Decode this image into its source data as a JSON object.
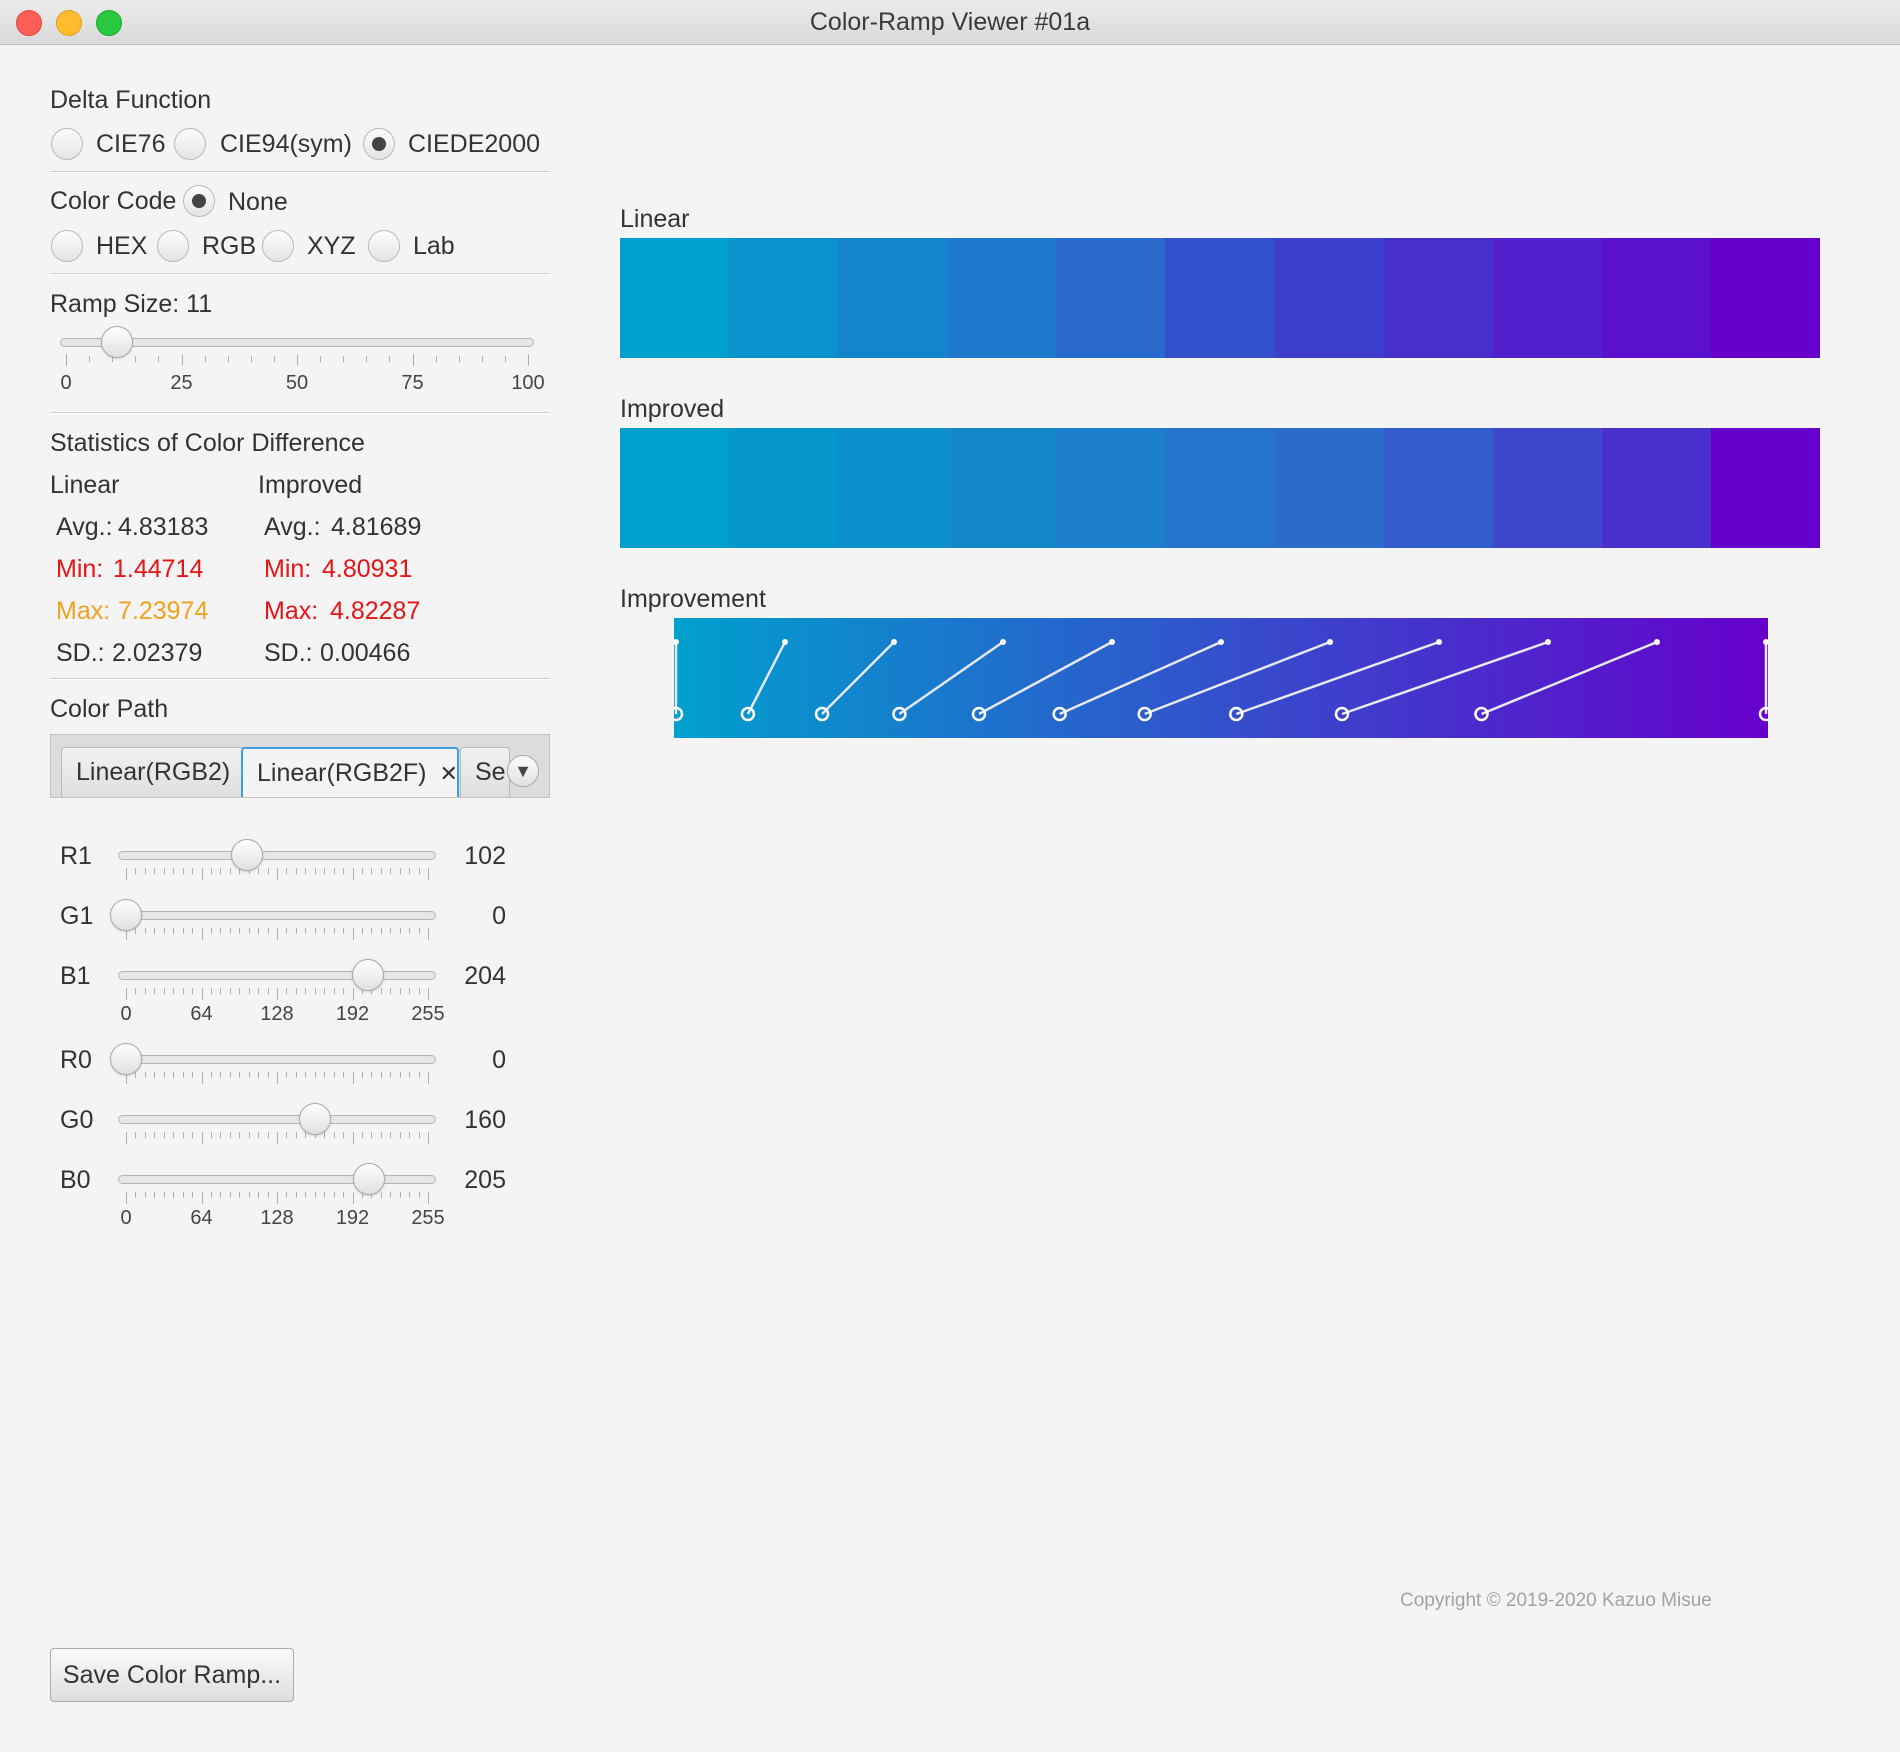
{
  "window": {
    "title": "Color-Ramp Viewer #01a"
  },
  "delta_function": {
    "label": "Delta Function",
    "options": [
      "CIE76",
      "CIE94(sym)",
      "CIEDE2000"
    ],
    "selected": "CIEDE2000"
  },
  "color_code": {
    "label": "Color Code",
    "options": [
      "None",
      "HEX",
      "RGB",
      "XYZ",
      "Lab"
    ],
    "selected": "None"
  },
  "ramp_size": {
    "label": "Ramp Size: 11",
    "value": 11,
    "min": 0,
    "max": 100,
    "tick_labels": [
      "0",
      "25",
      "50",
      "75",
      "100"
    ]
  },
  "statistics": {
    "title": "Statistics of Color Difference",
    "linear": {
      "header": "Linear",
      "avg_label": "Avg.:",
      "avg": "4.83183",
      "min_label": "Min:",
      "min": "1.44714",
      "max_label": "Max:",
      "max": "7.23974",
      "sd_label": "SD.:",
      "sd": "2.02379"
    },
    "improved": {
      "header": "Improved",
      "avg_label": "Avg.:",
      "avg": "4.81689",
      "min_label": "Min:",
      "min": "4.80931",
      "max_label": "Max:",
      "max": "4.82287",
      "sd_label": "SD.:",
      "sd": "0.00466"
    }
  },
  "color_path": {
    "label": "Color Path",
    "tabs": [
      {
        "label": "Linear(RGB2)"
      },
      {
        "label": "Linear(RGB2F)",
        "close": "✕"
      },
      {
        "label": "Se"
      }
    ],
    "menu_icon": "chevron-down-icon",
    "selected_tab": "Linear(RGB2F)"
  },
  "sliders": [
    {
      "label": "R1",
      "value": 102,
      "value_text": "102"
    },
    {
      "label": "G1",
      "value": 0,
      "value_text": "0"
    },
    {
      "label": "B1",
      "value": 204,
      "value_text": "204"
    },
    {
      "label": "R0",
      "value": 0,
      "value_text": "0"
    },
    {
      "label": "G0",
      "value": 160,
      "value_text": "160"
    },
    {
      "label": "B0",
      "value": 205,
      "value_text": "205"
    }
  ],
  "slider_scale": {
    "min": 0,
    "max": 255,
    "tick_labels": [
      "0",
      "64",
      "128",
      "192",
      "255"
    ]
  },
  "ramps": {
    "linear": {
      "label": "Linear",
      "colors": [
        "#00a0cd",
        "#0a92cc",
        "#1485cc",
        "#1e78cc",
        "#2a6acc",
        "#3350cc",
        "#3d3fcc",
        "#472fcc",
        "#5020cc",
        "#5a10cc",
        "#6600cc"
      ]
    },
    "improved": {
      "label": "Improved",
      "colors": [
        "#00a0cd",
        "#0698cc",
        "#0c90cc",
        "#1588cc",
        "#1d7fcc",
        "#2575cc",
        "#2c6acc",
        "#345ccc",
        "#3e48cc",
        "#4a30cc",
        "#6600cc"
      ]
    },
    "improvement": {
      "label": "Improvement",
      "from": "#00a0cd",
      "to": "#6600cc",
      "linear_positions": [
        0,
        0.1,
        0.2,
        0.3,
        0.4,
        0.5,
        0.6,
        0.7,
        0.8,
        0.9,
        1.0
      ],
      "improved_positions": [
        0,
        0.066,
        0.134,
        0.205,
        0.278,
        0.352,
        0.43,
        0.514,
        0.611,
        0.739,
        1.0
      ]
    }
  },
  "footer": {
    "copyright": "Copyright © 2019-2020 Kazuo Misue",
    "save_button": "Save Color Ramp..."
  }
}
